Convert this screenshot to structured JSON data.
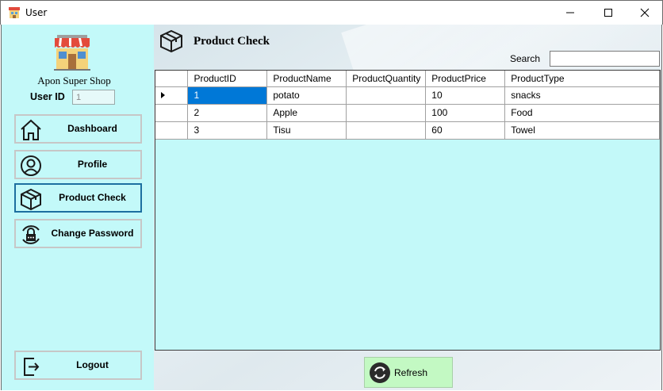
{
  "window": {
    "title": "User"
  },
  "sidebar": {
    "shop_name": "Apon Super Shop",
    "user_id_label": "User ID",
    "user_id_value": "1",
    "nav": {
      "dashboard": "Dashboard",
      "profile": "Profile",
      "product_check": "Product Check",
      "change_password": "Change Password",
      "logout": "Logout"
    },
    "active_item": "product_check"
  },
  "main": {
    "title": "Product Check",
    "search_label": "Search",
    "search_value": "",
    "table": {
      "columns": [
        "ProductID",
        "ProductName",
        "ProductQuantity",
        "ProductPrice",
        "ProductType"
      ],
      "rows": [
        [
          "1",
          "potato",
          "",
          "10",
          "snacks"
        ],
        [
          "2",
          "Apple",
          "",
          "100",
          "Food"
        ],
        [
          "3",
          "Tisu",
          "",
          "60",
          "Towel"
        ]
      ]
    },
    "refresh_label": "Refresh"
  },
  "colors": {
    "sidebar_bg": "#c3f9f9",
    "selection": "#0078d7",
    "active_border": "#1d6fa0",
    "refresh_bg": "#c3f9c3"
  }
}
